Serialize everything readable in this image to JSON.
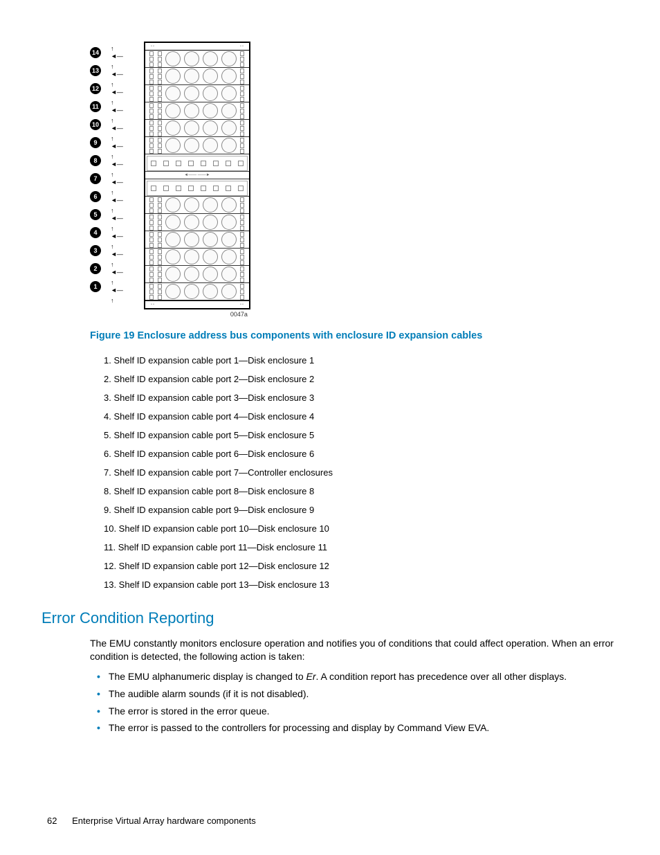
{
  "figure": {
    "label": "0047a",
    "caption": "Figure 19 Enclosure address bus components with enclosure ID expansion cables",
    "callouts": [
      "14",
      "13",
      "12",
      "11",
      "10",
      "9",
      "8",
      "7",
      "6",
      "5",
      "4",
      "3",
      "2",
      "1"
    ]
  },
  "legend": [
    "1. Shelf ID expansion cable port 1—Disk enclosure 1",
    "2. Shelf ID expansion cable port 2—Disk enclosure 2",
    "3. Shelf ID expansion cable port 3—Disk enclosure 3",
    "4. Shelf ID expansion cable port 4—Disk enclosure 4",
    "5. Shelf ID expansion cable port 5—Disk enclosure 5",
    "6. Shelf ID expansion cable port 6—Disk enclosure 6",
    "7. Shelf ID expansion cable port 7—Controller enclosures",
    "8. Shelf ID expansion cable port 8—Disk enclosure 8",
    "9. Shelf ID expansion cable port 9—Disk enclosure 9",
    "10. Shelf ID expansion cable port 10—Disk enclosure 10",
    "11. Shelf ID expansion cable port 11—Disk enclosure 11",
    "12. Shelf ID expansion cable port 12—Disk enclosure 12",
    "13. Shelf ID expansion cable port 13—Disk enclosure 13"
  ],
  "section": {
    "heading": "Error Condition Reporting",
    "intro": "The EMU constantly monitors enclosure operation and notifies you of conditions that could affect operation. When an error condition is detected, the following action is taken:",
    "bullets": [
      {
        "pre": "The EMU alphanumeric display is changed to ",
        "em": "Er",
        "post": ". A condition report has precedence over all other displays."
      },
      {
        "pre": "The audible alarm sounds (if it is not disabled).",
        "em": "",
        "post": ""
      },
      {
        "pre": "The error is stored in the error queue.",
        "em": "",
        "post": ""
      },
      {
        "pre": "The error is passed to the controllers for processing and display by Command View EVA.",
        "em": "",
        "post": ""
      }
    ]
  },
  "footer": {
    "page": "62",
    "title": "Enterprise Virtual Array hardware components"
  }
}
